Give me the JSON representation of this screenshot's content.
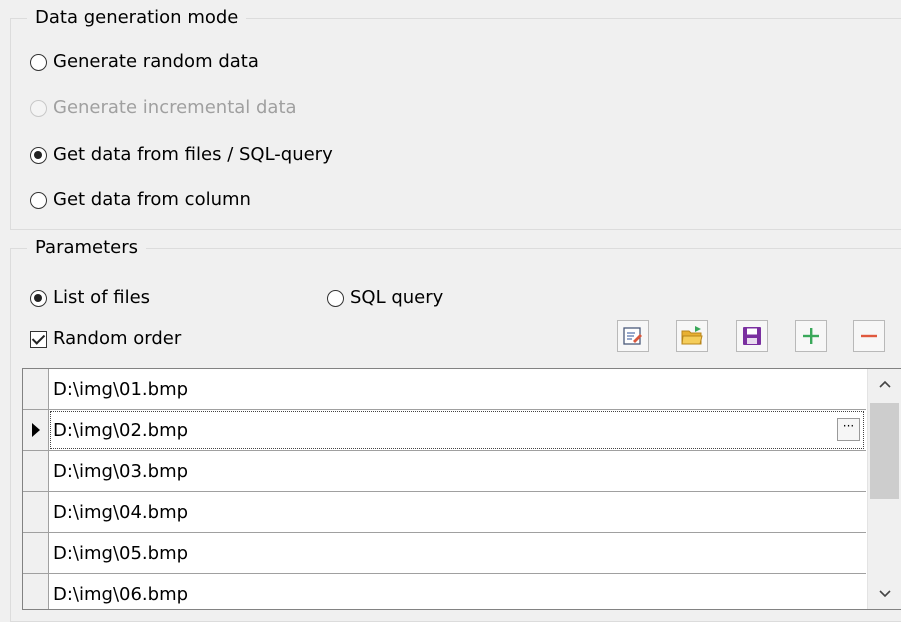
{
  "data_generation_mode": {
    "title": "Data generation mode",
    "options": [
      {
        "label": "Generate random data",
        "checked": false,
        "enabled": true
      },
      {
        "label": "Generate incremental data",
        "checked": false,
        "enabled": false
      },
      {
        "label": "Get data from files / SQL-query",
        "checked": true,
        "enabled": true
      },
      {
        "label": "Get data from column",
        "checked": false,
        "enabled": true
      }
    ]
  },
  "parameters": {
    "title": "Parameters",
    "source_options": [
      {
        "label": "List of files",
        "checked": true
      },
      {
        "label": "SQL query",
        "checked": false
      }
    ],
    "random_order": {
      "label": "Random order",
      "checked": true
    },
    "toolbar": [
      "edit-list-icon",
      "open-folder-icon",
      "save-icon",
      "add-icon",
      "remove-icon"
    ],
    "rows": [
      {
        "value": "D:\\img\\01.bmp",
        "current": false
      },
      {
        "value": "D:\\img\\02.bmp",
        "current": true
      },
      {
        "value": "D:\\img\\03.bmp",
        "current": false
      },
      {
        "value": "D:\\img\\04.bmp",
        "current": false
      },
      {
        "value": "D:\\img\\05.bmp",
        "current": false
      },
      {
        "value": "D:\\img\\06.bmp",
        "current": false
      }
    ],
    "ellipsis_label": "···"
  },
  "colors": {
    "add": "#3aa85a",
    "remove": "#e0593e",
    "save": "#7a2fa0",
    "folder": "#e8b032"
  }
}
